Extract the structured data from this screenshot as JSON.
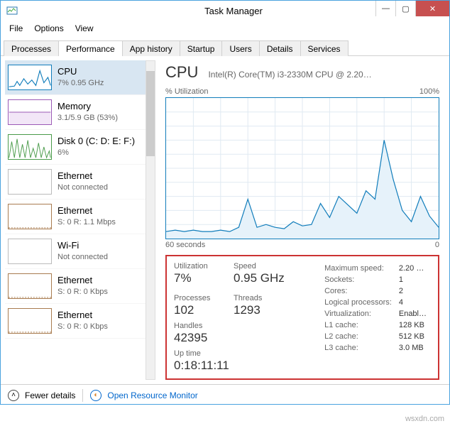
{
  "window": {
    "title": "Task Manager"
  },
  "menu": {
    "file": "File",
    "options": "Options",
    "view": "View"
  },
  "tabs": {
    "processes": "Processes",
    "performance": "Performance",
    "app_history": "App history",
    "startup": "Startup",
    "users": "Users",
    "details": "Details",
    "services": "Services"
  },
  "sidebar": {
    "cpu": {
      "title": "CPU",
      "sub": "7%  0.95 GHz"
    },
    "memory": {
      "title": "Memory",
      "sub": "3.1/5.9 GB (53%)"
    },
    "disk": {
      "title": "Disk 0 (C: D: E: F:)",
      "sub": "6%"
    },
    "eth0": {
      "title": "Ethernet",
      "sub": "Not connected"
    },
    "eth1": {
      "title": "Ethernet",
      "sub": "S: 0  R: 1.1 Mbps"
    },
    "wifi": {
      "title": "Wi-Fi",
      "sub": "Not connected"
    },
    "eth2": {
      "title": "Ethernet",
      "sub": "S: 0  R: 0 Kbps"
    },
    "eth3": {
      "title": "Ethernet",
      "sub": "S: 0  R: 0 Kbps"
    }
  },
  "main": {
    "title": "CPU",
    "subtitle": "Intel(R) Core(TM) i3-2330M CPU @ 2.20…",
    "chart_top_left": "% Utilization",
    "chart_top_right": "100%",
    "chart_bottom_left": "60 seconds",
    "chart_bottom_right": "0"
  },
  "stats": {
    "utilization_label": "Utilization",
    "utilization": "7%",
    "speed_label": "Speed",
    "speed": "0.95 GHz",
    "processes_label": "Processes",
    "processes": "102",
    "threads_label": "Threads",
    "threads": "1293",
    "handles_label": "Handles",
    "handles": "42395",
    "uptime_label": "Up time",
    "uptime": "0:18:11:11",
    "maxspeed_label": "Maximum speed:",
    "maxspeed": "2.20 …",
    "sockets_label": "Sockets:",
    "sockets": "1",
    "cores_label": "Cores:",
    "cores": "2",
    "logical_label": "Logical processors:",
    "logical": "4",
    "virt_label": "Virtualization:",
    "virt": "Enabl…",
    "l1_label": "L1 cache:",
    "l1": "128 KB",
    "l2_label": "L2 cache:",
    "l2": "512 KB",
    "l3_label": "L3 cache:",
    "l3": "3.0 MB"
  },
  "footer": {
    "fewer": "Fewer details",
    "orm": "Open Resource Monitor"
  },
  "watermark": "wsxdn.com",
  "chart_data": {
    "type": "line",
    "title": "% Utilization",
    "xlabel": "60 seconds → 0",
    "ylabel": "% Utilization",
    "ylim": [
      0,
      100
    ],
    "x_seconds_ago": [
      60,
      58,
      56,
      54,
      52,
      50,
      48,
      46,
      44,
      42,
      40,
      38,
      36,
      34,
      32,
      30,
      28,
      26,
      24,
      22,
      20,
      18,
      16,
      14,
      12,
      10,
      8,
      6,
      4,
      2,
      0
    ],
    "values": [
      5,
      6,
      5,
      6,
      5,
      5,
      6,
      5,
      8,
      28,
      8,
      10,
      8,
      7,
      12,
      9,
      10,
      25,
      15,
      30,
      24,
      18,
      34,
      28,
      70,
      42,
      20,
      12,
      30,
      16,
      8
    ]
  }
}
